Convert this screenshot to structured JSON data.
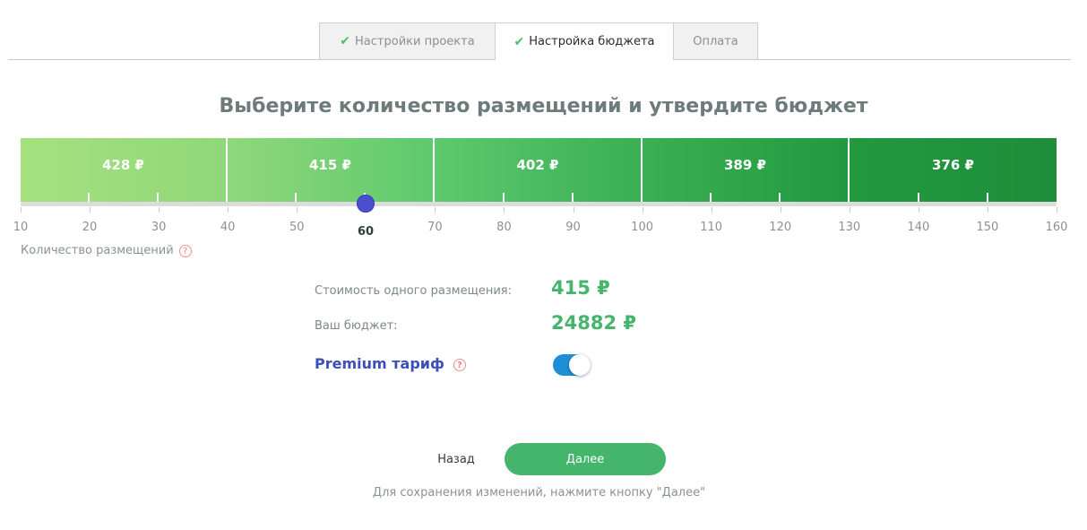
{
  "tabs": [
    {
      "label": "Настройки проекта",
      "checked": true,
      "active": false
    },
    {
      "label": "Настройка бюджета",
      "checked": true,
      "active": true
    },
    {
      "label": "Оплата",
      "checked": false,
      "active": false
    }
  ],
  "title": "Выберите количество размещений и утвердите бюджет",
  "price_bands": [
    {
      "label": "428 ₽",
      "from": 10,
      "to": 40
    },
    {
      "label": "415 ₽",
      "from": 40,
      "to": 70
    },
    {
      "label": "402 ₽",
      "from": 70,
      "to": 100
    },
    {
      "label": "389 ₽",
      "from": 100,
      "to": 130
    },
    {
      "label": "376 ₽",
      "from": 130,
      "to": 160
    }
  ],
  "band_colors": [
    "#a6e07f",
    "#8fd87a",
    "#5ec96d",
    "#3aaf53",
    "#23993f"
  ],
  "slider": {
    "min": 10,
    "max": 160,
    "ticks": [
      "10",
      "20",
      "30",
      "40",
      "50",
      "60",
      "70",
      "80",
      "90",
      "100",
      "110",
      "120",
      "130",
      "140",
      "150",
      "160"
    ],
    "current_value": "60"
  },
  "quantity_label": "Количество размещений",
  "help_glyph": "?",
  "cost_label": "Стоимость одного размещения:",
  "cost_value": "415 ₽",
  "budget_label": "Ваш бюджет:",
  "budget_value": "24882 ₽",
  "premium_label": "Premium тариф",
  "premium_enabled": true,
  "back_label": "Назад",
  "next_label": "Далее",
  "hint": "Для сохранения изменений, нажмите кнопку \"Далее\"",
  "check_glyph": "✔"
}
